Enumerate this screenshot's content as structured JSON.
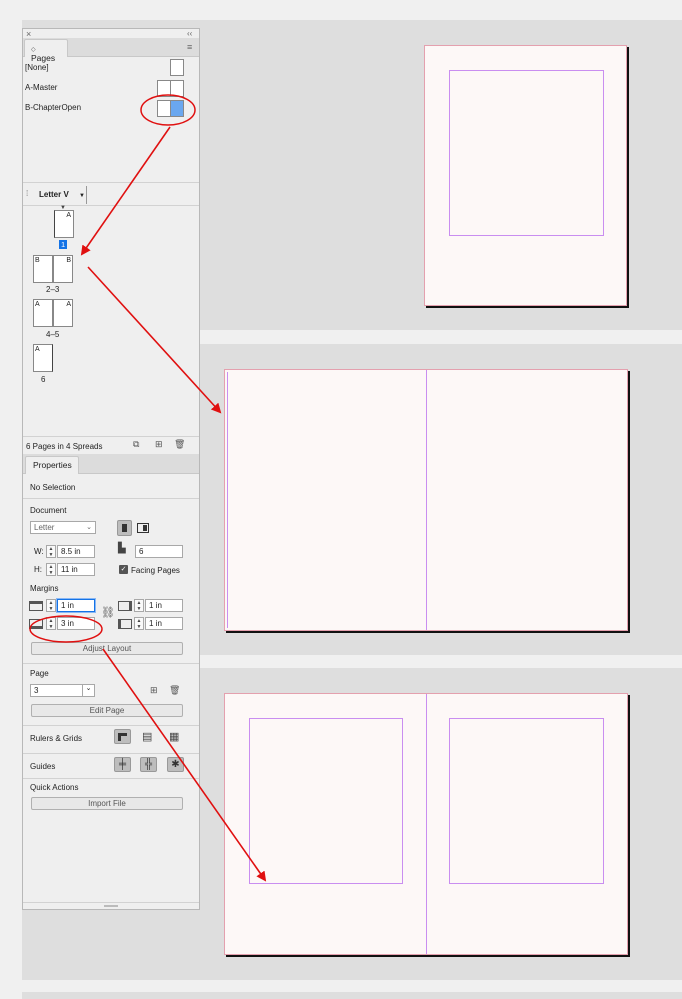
{
  "pages_panel": {
    "tab_label": "Pages",
    "masters": [
      "[None]",
      "A-Master",
      "B-ChapterOpen"
    ],
    "size_menu_label": "Letter V",
    "page_thumbs": [
      {
        "label": "1",
        "prefix_left": "",
        "prefix_right": "A"
      },
      {
        "label": "2–3",
        "prefix_left": "B",
        "prefix_right": "B"
      },
      {
        "label": "4–5",
        "prefix_left": "A",
        "prefix_right": "A"
      },
      {
        "label": "6",
        "prefix_left": "A",
        "prefix_right": ""
      }
    ],
    "footer_status": "6 Pages in 4 Spreads"
  },
  "properties": {
    "tab_label": "Properties",
    "selection_status": "No Selection",
    "document_heading": "Document",
    "preset_value": "Letter",
    "width_label": "W:",
    "width_value": "8.5 in",
    "height_label": "H:",
    "height_value": "11 in",
    "pages_value": "6",
    "facing_pages_label": "Facing Pages",
    "facing_pages_checked": true,
    "margins_heading": "Margins",
    "margin_top_value": "1 in",
    "margin_bottom_value": "3 in",
    "margin_inside_value": "1 in",
    "margin_outside_value": "1 in",
    "adjust_layout_label": "Adjust Layout",
    "page_heading": "Page",
    "page_value": "3",
    "edit_page_label": "Edit Page",
    "rulers_grids_label": "Rulers & Grids",
    "guides_label": "Guides",
    "quick_actions_label": "Quick Actions",
    "import_file_label": "Import File"
  },
  "colors": {
    "annotation_red": "#e01010",
    "margin_guide": "#c98ef0",
    "page_bleed": "#e4a0ae",
    "selection_blue": "#1473e6"
  }
}
